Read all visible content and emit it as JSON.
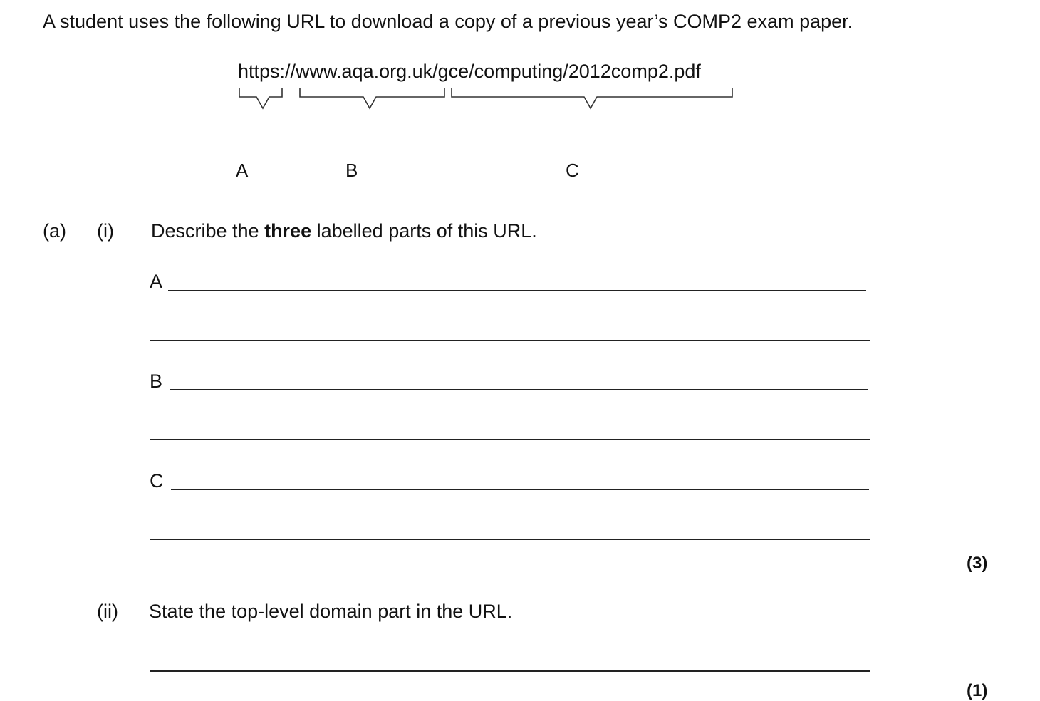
{
  "intro": "A student uses the following URL to download a copy of a previous year’s COMP2 exam paper.",
  "url": "https://www.aqa.org.uk/gce/computing/2012comp2.pdf",
  "url_parts": [
    "A",
    "B",
    "C"
  ],
  "question_a": {
    "label": "(a)",
    "part_i": {
      "label": "(i)",
      "text_before": "Describe the ",
      "text_bold": "three",
      "text_after": " labelled parts of this URL.",
      "answer_labels": [
        "A",
        "B",
        "C"
      ],
      "marks": "(3)"
    },
    "part_ii": {
      "label": "(ii)",
      "text": "State the top-level domain part in the URL.",
      "marks": "(1)"
    }
  }
}
